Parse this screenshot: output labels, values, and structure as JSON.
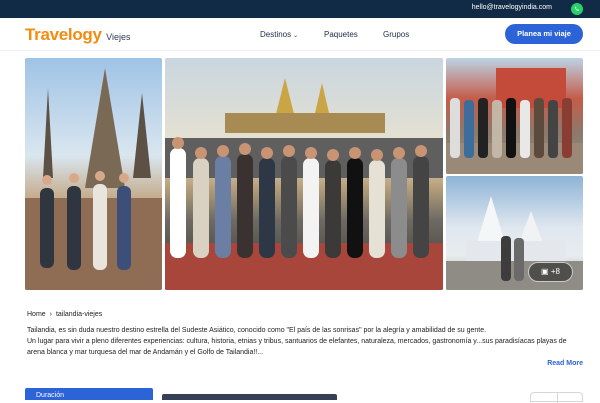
{
  "topbar": {
    "email": "hello@travelogyindia.com",
    "whatsapp_icon": "whatsapp-icon"
  },
  "brand": {
    "name": "Travelogy",
    "suffix": "Viejes"
  },
  "nav": {
    "items": [
      {
        "label": "Destinos",
        "has_dropdown": true
      },
      {
        "label": "Paquetes",
        "has_dropdown": false
      },
      {
        "label": "Grupos",
        "has_dropdown": false
      }
    ],
    "cta_label": "Planea mi viaje"
  },
  "gallery": {
    "more_count": "+8",
    "more_icon": "image-icon"
  },
  "breadcrumb": {
    "home": "Home",
    "current": "tailandia-viejes",
    "separator_icon": "chevron-right-icon"
  },
  "description": {
    "line1": "Tailandia, es sin duda nuestro destino estrella del Sudeste Asiático, conocido como \"El país de las sonrisas\" por la alegría y amabilidad de su gente.",
    "line2": "Un lugar para vivir a pleno diferentes experiencias: cultura, historia, etnias y tribus, santuarios de elefantes, naturaleza, mercados, gastronomía y...sus paradisíacas playas de arena blanca y mar turquesa del mar de Andamán y el Golfo de Tailandia!!...",
    "read_more": "Read More"
  },
  "filters": {
    "duration_label": "Duración"
  },
  "colors": {
    "topbar": "#112a46",
    "brand_orange": "#f28c0f",
    "accent_blue": "#2c63d6"
  }
}
